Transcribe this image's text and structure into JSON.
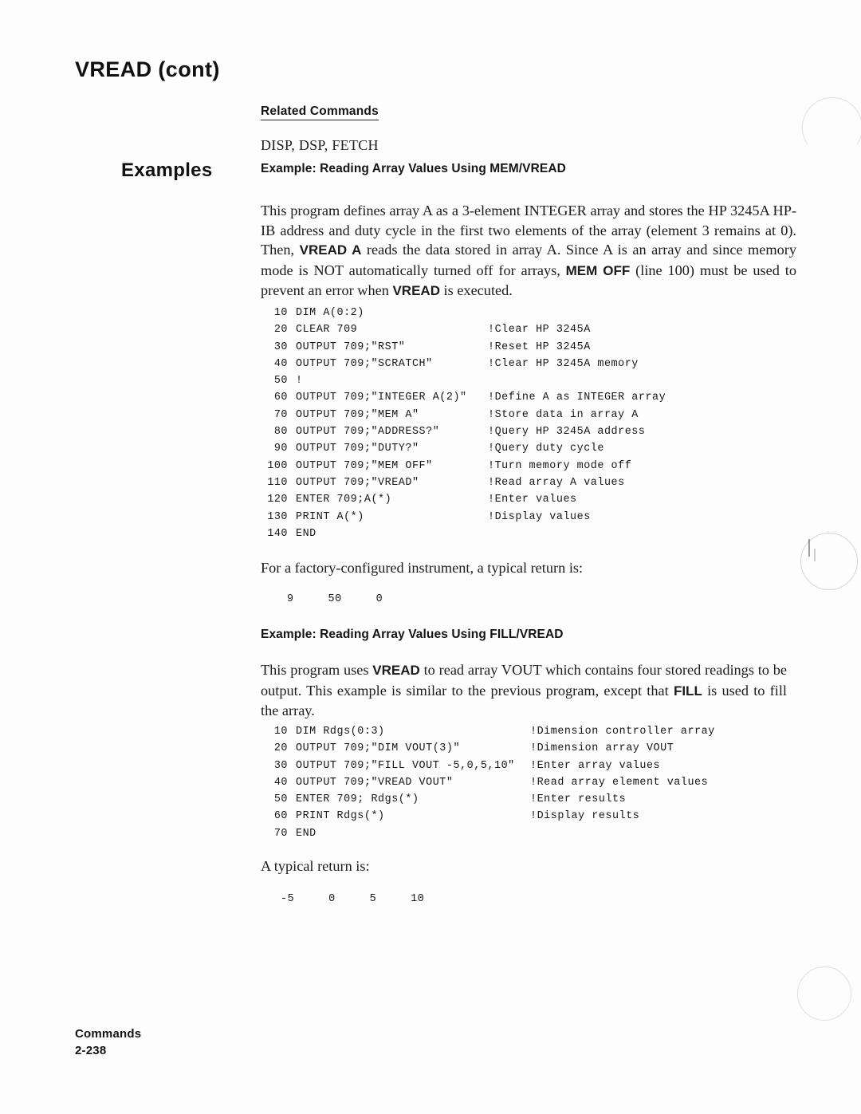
{
  "page": {
    "title": "VREAD (cont)",
    "gutter_label": "Examples"
  },
  "related_commands": {
    "heading": "Related Commands",
    "list": "DISP, DSP, FETCH"
  },
  "example_1": {
    "heading": "Example: Reading Array Values Using MEM/VREAD",
    "description_html": "This program defines array A as a 3-element INTEGER array and stores the HP 3245A HP-IB address and duty cycle in the first two elements of the array (element 3 remains at 0). Then, <b>VREAD A</b> reads the data stored in array A. Since A is an array and since memory mode is NOT automatically turned off for arrays, <b>MEM OFF</b> (line 100) must be used to prevent an error when <b>VREAD</b> is executed.",
    "code": [
      {
        "line": "10",
        "statement": "DIM A(0:2)",
        "comment": ""
      },
      {
        "line": "20",
        "statement": "CLEAR 709",
        "comment": "!Clear HP 3245A"
      },
      {
        "line": "30",
        "statement": "OUTPUT 709;\"RST\"",
        "comment": "!Reset HP 3245A"
      },
      {
        "line": "40",
        "statement": "OUTPUT 709;\"SCRATCH\"",
        "comment": "!Clear HP 3245A memory"
      },
      {
        "line": "50",
        "statement": "!",
        "comment": ""
      },
      {
        "line": "60",
        "statement": "OUTPUT 709;\"INTEGER A(2)\"",
        "comment": "!Define A as INTEGER array"
      },
      {
        "line": "70",
        "statement": "OUTPUT 709;\"MEM A\"",
        "comment": "!Store data in array A"
      },
      {
        "line": "80",
        "statement": "OUTPUT 709;\"ADDRESS?\"",
        "comment": "!Query HP 3245A address"
      },
      {
        "line": "90",
        "statement": "OUTPUT 709;\"DUTY?\"",
        "comment": "!Query duty cycle"
      },
      {
        "line": "100",
        "statement": "OUTPUT 709;\"MEM OFF\"",
        "comment": "!Turn memory mode off"
      },
      {
        "line": "110",
        "statement": "OUTPUT 709;\"VREAD\"",
        "comment": "!Read array A values"
      },
      {
        "line": "120",
        "statement": "ENTER 709;A(*)",
        "comment": "!Enter values"
      },
      {
        "line": "130",
        "statement": "PRINT A(*)",
        "comment": "!Display values"
      },
      {
        "line": "140",
        "statement": "END",
        "comment": ""
      }
    ],
    "return_intro": "For a factory-configured instrument, a typical return is:",
    "return_values": "9     50     0"
  },
  "example_2": {
    "heading": "Example: Reading Array Values Using FILL/VREAD",
    "description_html": "This program uses <b>VREAD</b> to read array VOUT which contains four stored readings to be output. This example is similar to the previous program, except that <b>FILL</b> is used to fill the array.",
    "code": [
      {
        "line": "10",
        "statement": "DIM Rdgs(0:3)",
        "comment": "!Dimension controller array"
      },
      {
        "line": "20",
        "statement": "OUTPUT 709;\"DIM VOUT(3)\"",
        "comment": "!Dimension array VOUT"
      },
      {
        "line": "30",
        "statement": "OUTPUT 709;\"FILL VOUT -5,0,5,10\"",
        "comment": "!Enter array values"
      },
      {
        "line": "40",
        "statement": "OUTPUT 709;\"VREAD VOUT\"",
        "comment": "!Read array element values"
      },
      {
        "line": "50",
        "statement": "ENTER 709; Rdgs(*)",
        "comment": "!Enter results"
      },
      {
        "line": "60",
        "statement": "PRINT Rdgs(*)",
        "comment": "!Display results"
      },
      {
        "line": "70",
        "statement": "END",
        "comment": ""
      }
    ],
    "return_intro": "A typical return is:",
    "return_values": "-5     0     5     10"
  },
  "footer": {
    "section": "Commands",
    "page_number": "2-238"
  },
  "colors": {
    "page_background": "#fdfdfd",
    "text": "#1a1a1a",
    "rule": "#232323"
  }
}
